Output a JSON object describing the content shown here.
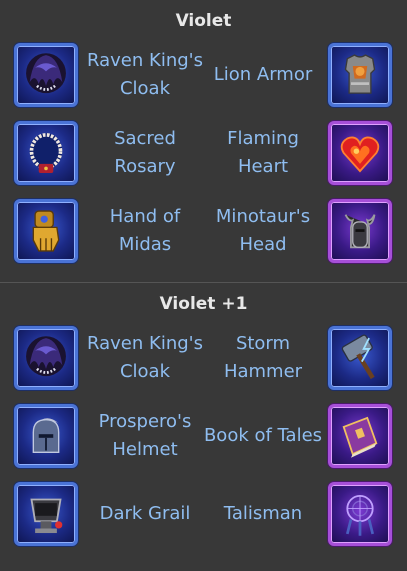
{
  "sections": [
    {
      "title": "Violet",
      "rows": [
        {
          "left": {
            "name": "Raven King's Cloak",
            "icon": "raven-cloak-icon"
          },
          "right": {
            "name": "Lion Armor",
            "icon": "lion-armor-icon"
          }
        },
        {
          "left": {
            "name": "Sacred Rosary",
            "icon": "rosary-icon"
          },
          "right": {
            "name": "Flaming Heart",
            "icon": "flaming-heart-icon"
          }
        },
        {
          "left": {
            "name": "Hand of Midas",
            "icon": "golden-gauntlet-icon"
          },
          "right": {
            "name": "Minotaur's Head",
            "icon": "minotaur-helmet-icon"
          }
        }
      ]
    },
    {
      "title": "Violet +1",
      "rows": [
        {
          "left": {
            "name": "Raven King's Cloak",
            "icon": "raven-cloak-icon"
          },
          "right": {
            "name": "Storm Hammer",
            "icon": "storm-hammer-icon"
          }
        },
        {
          "left": {
            "name": "Prospero's Helmet",
            "icon": "plumed-helmet-icon"
          },
          "right": {
            "name": "Book of Tales",
            "icon": "book-icon"
          }
        },
        {
          "left": {
            "name": "Dark Grail",
            "icon": "dark-grail-icon"
          },
          "right": {
            "name": "Talisman",
            "icon": "talisman-icon"
          }
        }
      ]
    }
  ],
  "colors": {
    "background": "#383838",
    "title": "#e8e8e8",
    "label": "#8fbdf0",
    "blue_frame": "#4a73d6",
    "purple_frame": "#a64fd8"
  }
}
